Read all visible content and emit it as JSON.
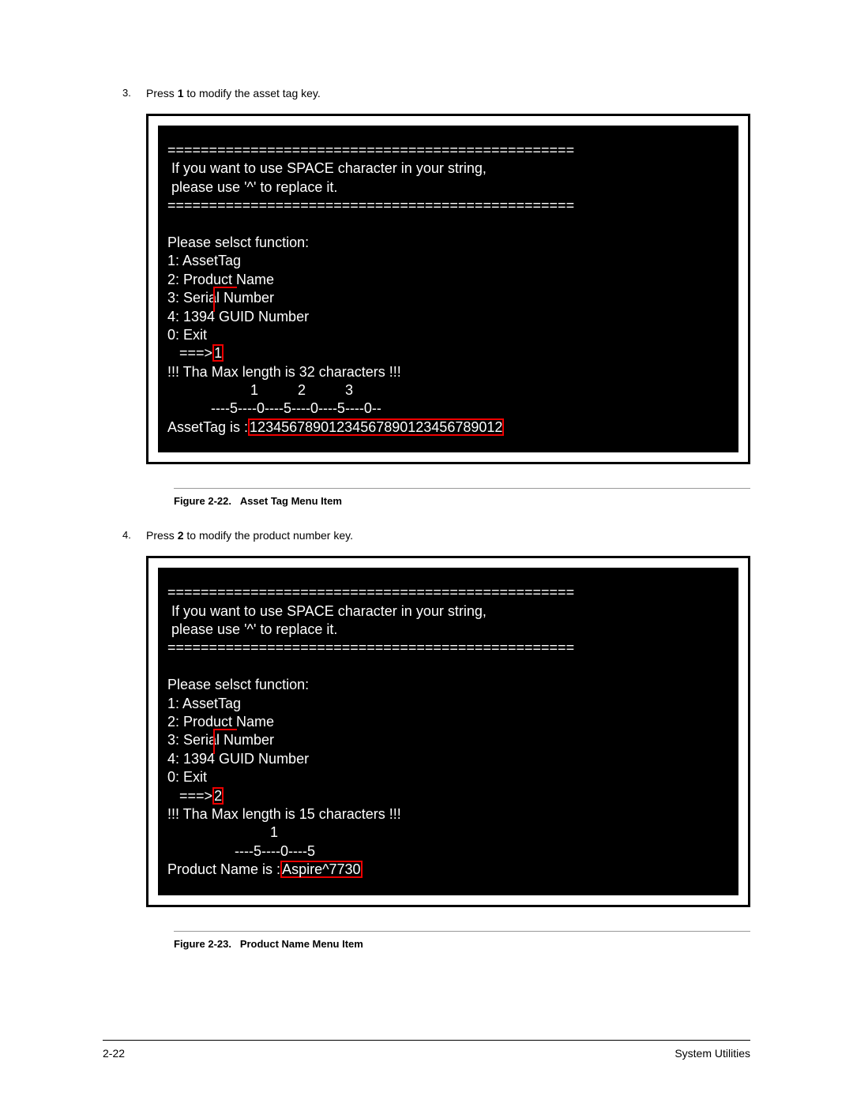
{
  "step3": {
    "num": "3.",
    "text_before": "Press ",
    "key": "1",
    "text_after": " to modify the asset tag key."
  },
  "terminal1": {
    "divider_top": "=================================================",
    "notice_line1": " If you want to use SPACE character in your string,",
    "notice_line2": " please use '^' to replace it.",
    "divider_bottom": "=================================================",
    "func_prompt": "Please selsct function:",
    "opt1": "1: AssetTag",
    "opt2": "2: Product Name",
    "opt3": "3: Serial Number",
    "opt4": "4: 1394 GUID Number",
    "opt0": "0: Exit",
    "arrow": "   ===>",
    "input": "1",
    "maxlen": "!!! Tha Max length is 32 characters !!!",
    "scale_nums": "                     1          2          3",
    "scale_marks": "           ----5----0----5----0----5----0--",
    "result_label": "AssetTag is :",
    "result_value": "12345678901234567890123456789012"
  },
  "figure1": {
    "label": "Figure 2-22.",
    "title": "Asset Tag Menu Item"
  },
  "step4": {
    "num": "4.",
    "text_before": "Press ",
    "key": "2",
    "text_after": " to modify the product number key."
  },
  "terminal2": {
    "divider_top": "=================================================",
    "notice_line1": " If you want to use SPACE character in your string,",
    "notice_line2": " please use '^' to replace it.",
    "divider_bottom": "=================================================",
    "func_prompt": "Please selsct function:",
    "opt1": "1: AssetTag",
    "opt2": "2: Product Name",
    "opt3": "3: Serial Number",
    "opt4": "4: 1394 GUID Number",
    "opt0": "0: Exit",
    "arrow": "   ===>",
    "input": "2",
    "maxlen": "!!! Tha Max length is 15 characters !!!",
    "scale_nums": "                          1",
    "scale_marks": "                 ----5----0----5",
    "result_label": "Product Name is :",
    "result_value": "Aspire^7730"
  },
  "figure2": {
    "label": "Figure 2-23.",
    "title": "Product Name Menu Item"
  },
  "footer": {
    "page": "2-22",
    "section": "System Utilities"
  }
}
